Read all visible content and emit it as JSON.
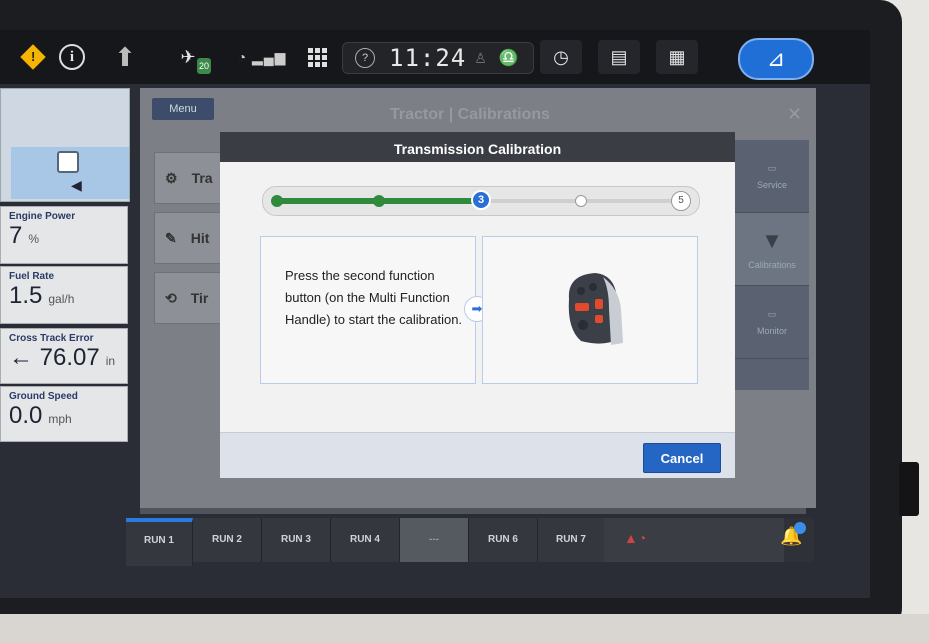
{
  "status_bar": {
    "warning_icon": "warning-diamond-icon",
    "warning_glyph": "!",
    "info_glyph": "i",
    "clock_icon_glyph": "?",
    "time": "11:24",
    "gps_badge": "20"
  },
  "left_widgets": [
    {
      "label": "Engine Power",
      "value": "7",
      "unit": "%"
    },
    {
      "label": "Fuel Rate",
      "value": "1.5",
      "unit": "gal/h"
    },
    {
      "label": "Cross Track Error",
      "value": "← 76.07",
      "unit": "in"
    },
    {
      "label": "Ground Speed",
      "value": "0.0",
      "unit": "mph"
    }
  ],
  "background_page": {
    "menu_label": "Menu",
    "title": "Tractor | Calibrations",
    "rows": [
      "Tra",
      "Hit",
      "Tir"
    ],
    "right_nav": [
      "Service",
      "Calibrations",
      "Monitor"
    ]
  },
  "dialog": {
    "title": "Transmission Calibration",
    "current_step": "3",
    "total_steps": "5",
    "progress_fraction": 0.5,
    "instruction": "Press the second function button (on the Multi Function Handle) to start the calibration.",
    "cancel_label": "Cancel"
  },
  "run_bar": {
    "tabs": [
      "RUN 1",
      "RUN 2",
      "RUN 3",
      "RUN 4",
      "---",
      "RUN 6",
      "RUN 7"
    ]
  },
  "colors": {
    "accent": "#2565c4",
    "progress_done": "#2f8a3b",
    "warning": "#f5b400"
  }
}
